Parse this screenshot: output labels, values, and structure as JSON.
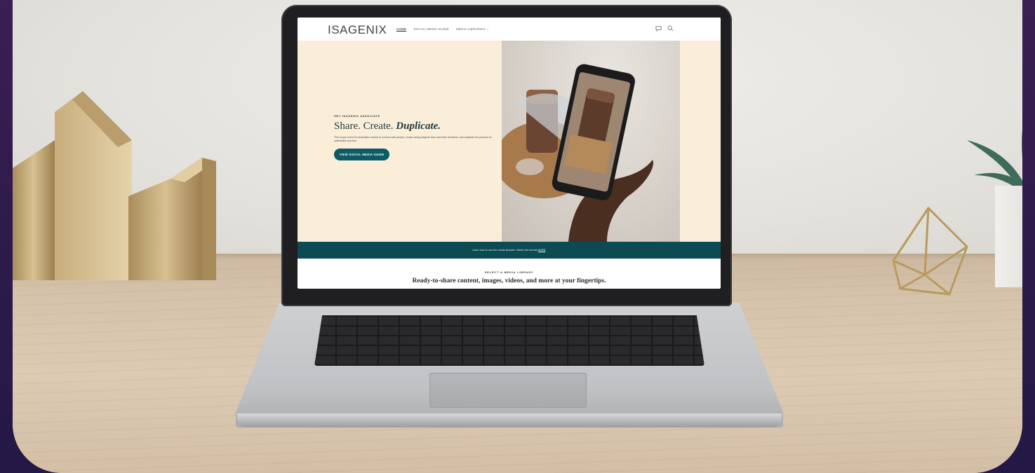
{
  "site": {
    "logo": "ISAGENIX",
    "nav": {
      "home": "HOME",
      "social_media_guide": "SOCIAL MEDIA GUIDE",
      "media_libraries": "MEDIA LIBRARIES ⌄"
    },
    "icons": [
      "chat-icon",
      "search-icon"
    ]
  },
  "hero": {
    "eyebrow": "HEY ISAGENIX ASSOCIATE",
    "headline_plain": "Share. Create. ",
    "headline_emphasis": "Duplicate.",
    "intro": "This is your home for shareable content to connect with people, create raving Isagenix fans and team members, and duplicate the process for undeniable success.",
    "cta_label": "VIEW SOCIAL MEDIA GUIDE"
  },
  "band": {
    "text": "Learn how to use the media libraries. Watch the tutorial ",
    "link": "HERE"
  },
  "library": {
    "eyebrow": "SELECT A MEDIA LIBRARY",
    "title": "Ready-to-share content, images, videos, and more at your fingertips."
  },
  "colors": {
    "brand_teal": "#0c5a66",
    "band_teal": "#0c4b52",
    "hero_cream": "#fbeed9",
    "frame_purple": "#2b1a4a"
  }
}
